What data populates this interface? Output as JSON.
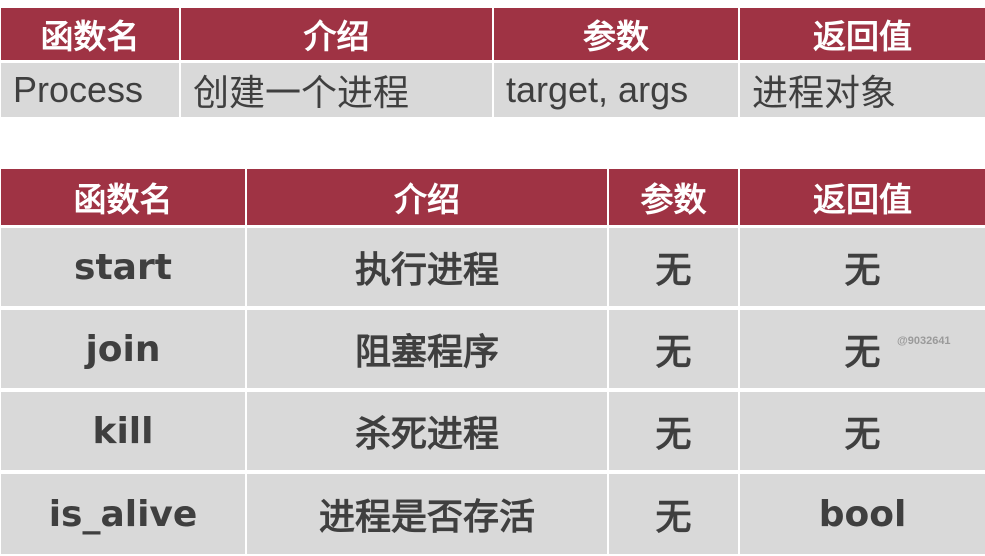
{
  "table1": {
    "headers": [
      "函数名",
      "介绍",
      "参数",
      "返回值"
    ],
    "row": [
      "Process",
      "创建一个进程",
      "target, args",
      "进程对象"
    ]
  },
  "table2": {
    "headers": [
      "函数名",
      "介绍",
      "参数",
      "返回值"
    ],
    "rows": [
      [
        "start",
        "执行进程",
        "无",
        "无"
      ],
      [
        "join",
        "阻塞程序",
        "无",
        "无"
      ],
      [
        "kill",
        "杀死进程",
        "无",
        "无"
      ],
      [
        "is_alive",
        "进程是否存活",
        "无",
        "bool"
      ]
    ]
  },
  "watermark": "@9032641"
}
